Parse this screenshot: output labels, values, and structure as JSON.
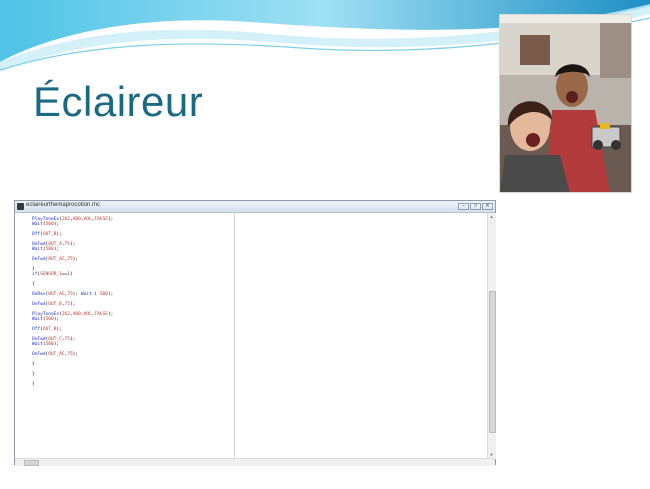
{
  "slide": {
    "title": "Éclaireur"
  },
  "window": {
    "title": "eclaireurthemaprocotion.mc",
    "buttons": {
      "minimize": "–",
      "maximize": "□",
      "close": "✕"
    }
  },
  "photo": {
    "description_icon": "photo-icon"
  },
  "code": {
    "lines": [
      "PlayToneEx(262,400,VOL,FALSE);",
      "Wait(500);",
      "",
      "Off(OUT_B);",
      "",
      "OnFwd(OUT_A,75);",
      "Wait(500);",
      "",
      "OnFwd(OUT_AC,75);",
      "",
      "}",
      "if(SENSOR_1==1)",
      "",
      "{",
      "",
      "OnRev(OUT_AC,75); Wait ( 500);",
      "",
      "OnFwd(OUT_B,75);",
      "",
      "PlayToneEx(262,400,VOL,FALSE);",
      "Wait(500);",
      "",
      "Off(OUT_B);",
      "",
      "OnFwd(OUT_C,75);",
      "Wait(500);",
      "",
      "OnFwd(OUT_AC,75);",
      "",
      "}",
      "",
      "}",
      "",
      "}"
    ]
  }
}
